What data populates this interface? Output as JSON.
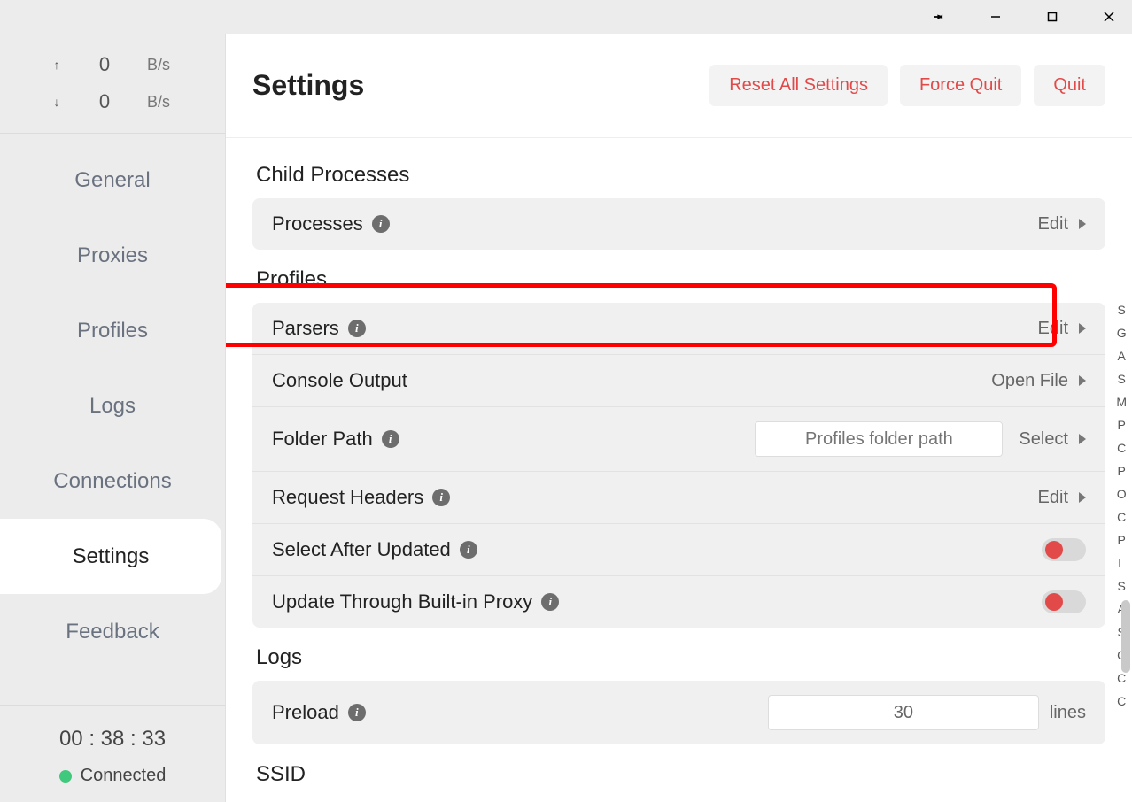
{
  "titlebar": {
    "pin": "📌"
  },
  "speed": {
    "up_val": "0",
    "down_val": "0",
    "unit": "B/s"
  },
  "nav": {
    "items": [
      "General",
      "Proxies",
      "Profiles",
      "Logs",
      "Connections",
      "Settings",
      "Feedback"
    ],
    "active_index": 5
  },
  "status": {
    "time": "00 : 38 : 33",
    "label": "Connected"
  },
  "header": {
    "title": "Settings",
    "reset": "Reset All Settings",
    "force_quit": "Force Quit",
    "quit": "Quit"
  },
  "sections": {
    "child_processes": {
      "title": "Child Processes",
      "processes_label": "Processes",
      "edit": "Edit"
    },
    "profiles": {
      "title": "Profiles",
      "parsers": "Parsers",
      "console_output": "Console Output",
      "open_file": "Open File",
      "folder_path": "Folder Path",
      "folder_placeholder": "Profiles folder path",
      "select": "Select",
      "request_headers": "Request Headers",
      "select_after_updated": "Select After Updated",
      "update_through_proxy": "Update Through Built-in Proxy",
      "edit": "Edit"
    },
    "logs": {
      "title": "Logs",
      "preload": "Preload",
      "preload_value": "30",
      "lines": "lines"
    },
    "ssid": {
      "title": "SSID"
    }
  },
  "right_index": [
    "S",
    "G",
    "A",
    "S",
    "M",
    "P",
    "C",
    "P",
    "O",
    "C",
    "P",
    "L",
    "S",
    "A",
    "S",
    "C",
    "C",
    "C"
  ]
}
